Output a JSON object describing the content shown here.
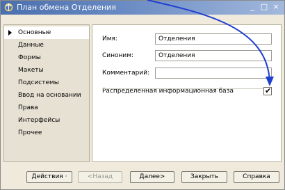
{
  "window": {
    "title": "План обмена Отделения",
    "controls": [
      "_",
      "□",
      "×"
    ]
  },
  "nav": {
    "items": [
      {
        "label": "Основные",
        "active": true
      },
      {
        "label": "Данные",
        "active": false
      },
      {
        "label": "Формы",
        "active": false
      },
      {
        "label": "Макеты",
        "active": false
      },
      {
        "label": "Подсистемы",
        "active": false
      },
      {
        "label": "Ввод на основании",
        "active": false
      },
      {
        "label": "Права",
        "active": false
      },
      {
        "label": "Интерфейсы",
        "active": false
      },
      {
        "label": "Прочее",
        "active": false
      }
    ]
  },
  "form": {
    "name_label": "Имя:",
    "name_value": "Отделения",
    "synonym_label": "Синоним:",
    "synonym_value": "Отделения",
    "comment_label": "Комментарий:",
    "comment_value": "",
    "distributed_label": "Распределенная информационная база",
    "distributed_checked": "✔"
  },
  "buttons": {
    "actions": "Действия ·",
    "back": "<Назад",
    "next": "Далее>",
    "close": "Закрыть",
    "help": "Справка"
  },
  "colors": {
    "arrow": "#1f3fd0",
    "titlebar": "#4a6fae"
  }
}
